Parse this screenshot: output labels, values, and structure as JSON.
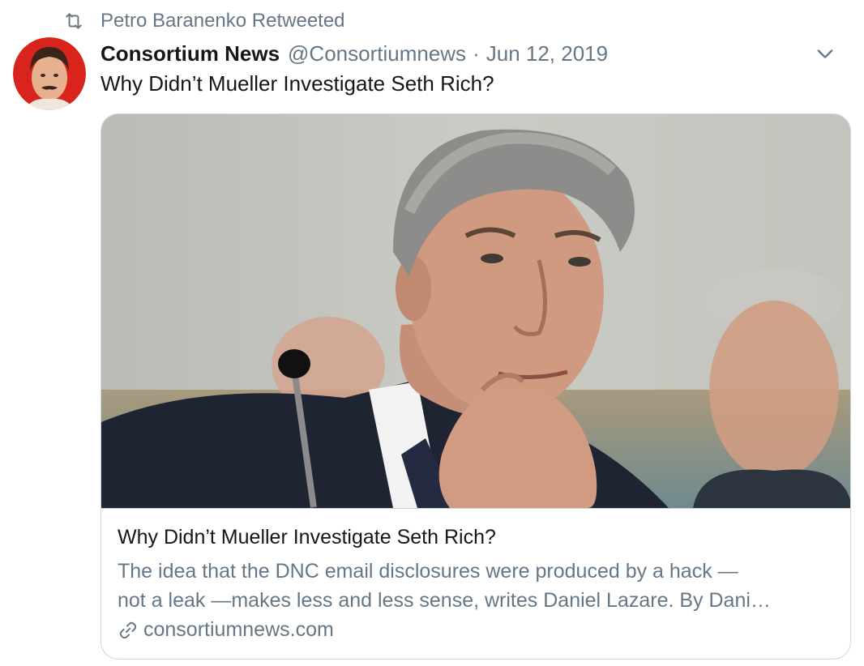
{
  "retweet": {
    "icon": "retweet-icon",
    "text": "Petro Baranenko Retweeted"
  },
  "tweet": {
    "display_name": "Consortium News",
    "handle": "@Consortiumnews",
    "separator": "·",
    "date": "Jun 12, 2019",
    "text": "Why Didn’t Mueller Investigate Seth Rich?",
    "menu_icon": "chevron-down-icon"
  },
  "card": {
    "title": "Why Didn’t Mueller Investigate Seth Rich?",
    "description_line1": "The idea that the DNC email disclosures were produced by a hack —",
    "description_line2": "not a leak —makes less and less sense, writes Daniel Lazare. By Dani…",
    "link_icon": "link-icon",
    "domain": "consortiumnews.com"
  },
  "colors": {
    "text_primary": "#14171a",
    "text_secondary": "#657786",
    "border": "#ccd6dd"
  }
}
